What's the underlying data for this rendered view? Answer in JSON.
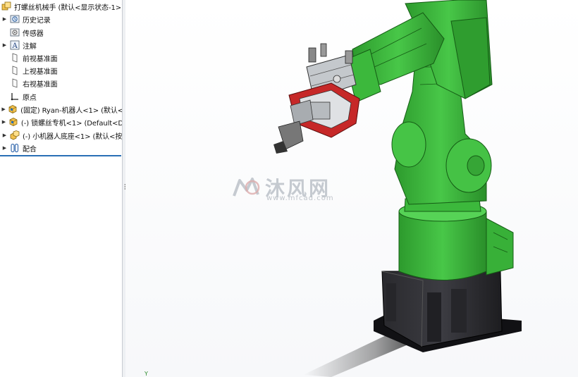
{
  "feature_tree": {
    "root": {
      "label": "打螺丝机械手  (默认<显示状态-1>)",
      "icon": "assembly-icon"
    },
    "items": [
      {
        "label": "历史记录",
        "icon": "history-icon",
        "expandable": true
      },
      {
        "label": "传感器",
        "icon": "sensor-icon",
        "expandable": false
      },
      {
        "label": "注解",
        "icon": "annotation-icon",
        "expandable": true
      },
      {
        "label": "前视基准面",
        "icon": "plane-icon",
        "expandable": false
      },
      {
        "label": "上视基准面",
        "icon": "plane-icon",
        "expandable": false
      },
      {
        "label": "右视基准面",
        "icon": "plane-icon",
        "expandable": false
      },
      {
        "label": "原点",
        "icon": "origin-icon",
        "expandable": false
      },
      {
        "label": "(固定) Ryan-机器人<1> (默认<",
        "icon": "part-icon",
        "expandable": true
      },
      {
        "label": "(-) 锁螺丝专机<1> (Default<D",
        "icon": "part-icon",
        "expandable": true
      },
      {
        "label": "(-) 小机器人底座<1> (默认<按",
        "icon": "subassembly-icon",
        "expandable": true
      },
      {
        "label": "配合",
        "icon": "mates-icon",
        "expandable": true
      }
    ]
  },
  "viewport": {
    "watermark_cn": "沐风网",
    "watermark_url": "www.mfcad.com",
    "triad_label": "Y"
  },
  "colors": {
    "robot_green": "#3fbf3f",
    "robot_green_dark": "#1f7a1f",
    "base_black": "#1b1b1e",
    "gripper_red": "#c62828",
    "selection_blue": "#2a6fb5"
  }
}
